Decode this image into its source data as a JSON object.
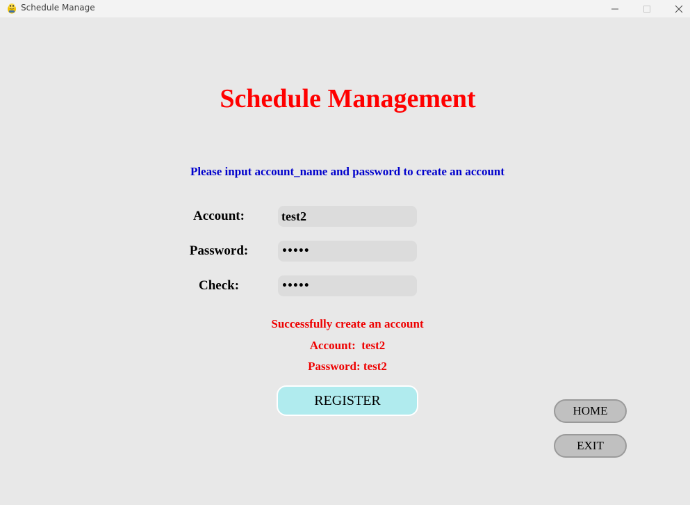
{
  "window": {
    "title": "Schedule Manage",
    "icon": "python-snake-icon"
  },
  "header": {
    "title": "Schedule Management",
    "instruction": "Please input account_name and password to create an account"
  },
  "form": {
    "account_label": "Account:",
    "account_value": "test2",
    "password_label": "Password:",
    "password_value": "•••••",
    "check_label": "Check:",
    "check_value": "•••••"
  },
  "status": {
    "line1": "Successfully create an account",
    "line2": "Account:  test2",
    "line3": "Password: test2"
  },
  "buttons": {
    "register": "REGISTER",
    "home": "HOME",
    "exit": "EXIT"
  },
  "colors": {
    "background": "#e8e8e8",
    "title": "#ff0000",
    "instruction": "#0000cc",
    "status": "#ee0000",
    "register_button": "#b0ebee",
    "side_button": "#c0c0c0",
    "input_background": "#dcdcdc"
  }
}
